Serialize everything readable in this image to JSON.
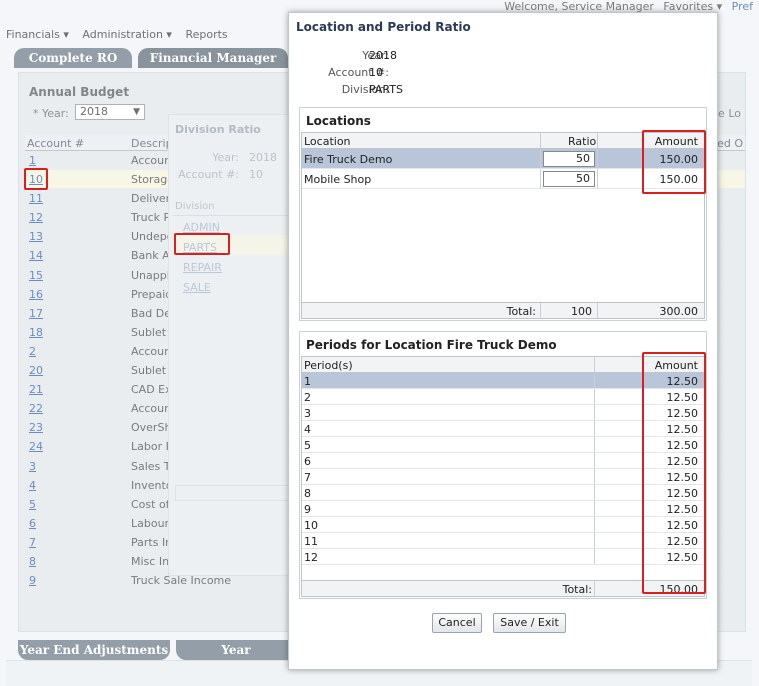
{
  "topbar": {
    "welcome": "Welcome, Service Manager",
    "favorites": "Favorites ▾",
    "prefs": "Pref"
  },
  "menu": {
    "financials": "Financials ▾",
    "administration": "Administration ▾",
    "reports": "Reports"
  },
  "tabs": {
    "complete_ro": "Complete RO",
    "financial_manager": "Financial Manager"
  },
  "bottom_tabs": {
    "year_end": "Year End Adjustments",
    "year_depr": "Year Depreciation"
  },
  "budget": {
    "title": "Annual Budget",
    "year_label": "* Year:",
    "year_value": "2018",
    "col_account": "Account #",
    "col_desc": "Descript",
    "right_label_1": "fine Lo",
    "right_label_2": "ased O",
    "rows": [
      {
        "acct": "1",
        "desc": "Account"
      },
      {
        "acct": "10",
        "desc": "Storage"
      },
      {
        "acct": "11",
        "desc": "Delivery"
      },
      {
        "acct": "12",
        "desc": "Truck P"
      },
      {
        "acct": "13",
        "desc": "Undepo"
      },
      {
        "acct": "14",
        "desc": "Bank Ac"
      },
      {
        "acct": "15",
        "desc": "Unappli"
      },
      {
        "acct": "16",
        "desc": "Prepaid"
      },
      {
        "acct": "17",
        "desc": "Bad Del"
      },
      {
        "acct": "18",
        "desc": "Sublet E"
      },
      {
        "acct": "2",
        "desc": "Account"
      },
      {
        "acct": "20",
        "desc": "Sublet L"
      },
      {
        "acct": "21",
        "desc": "CAD Ex"
      },
      {
        "acct": "22",
        "desc": "Account"
      },
      {
        "acct": "23",
        "desc": "OverSho"
      },
      {
        "acct": "24",
        "desc": "Labor E"
      },
      {
        "acct": "3",
        "desc": "Sales Ta"
      },
      {
        "acct": "4",
        "desc": "Invento"
      },
      {
        "acct": "5",
        "desc": "Cost of"
      },
      {
        "acct": "6",
        "desc": "Labour"
      },
      {
        "acct": "7",
        "desc": "Parts In"
      },
      {
        "acct": "8",
        "desc": "Misc Inc"
      },
      {
        "acct": "9",
        "desc": "Truck Sale Income"
      }
    ]
  },
  "division_ratio": {
    "title": "Division Ratio",
    "year_label": "Year:",
    "year_value": "2018",
    "account_label": "Account #:",
    "account_value": "10",
    "col_division": "Division",
    "items": [
      "ADMIN",
      "PARTS",
      "REPAIR",
      "SALE"
    ]
  },
  "dialog": {
    "title": "Location and Period Ratio",
    "year_label": "Year:",
    "year_value": "2018",
    "account_label": "Account #:",
    "account_value": "10",
    "division_label": "Division:",
    "division_value": "PARTS",
    "locations": {
      "title": "Locations",
      "col_location": "Location",
      "col_ratio": "Ratio",
      "col_amount": "Amount",
      "rows": [
        {
          "location": "Fire Truck Demo",
          "ratio": "50",
          "amount": "150.00"
        },
        {
          "location": "Mobile Shop",
          "ratio": "50",
          "amount": "150.00"
        }
      ],
      "total_label": "Total:",
      "total_ratio": "100",
      "total_amount": "300.00"
    },
    "periods": {
      "title": "Periods for Location Fire Truck Demo",
      "col_period": "Period(s)",
      "col_amount": "Amount",
      "rows": [
        {
          "period": "1",
          "amount": "12.50"
        },
        {
          "period": "2",
          "amount": "12.50"
        },
        {
          "period": "3",
          "amount": "12.50"
        },
        {
          "period": "4",
          "amount": "12.50"
        },
        {
          "period": "5",
          "amount": "12.50"
        },
        {
          "period": "6",
          "amount": "12.50"
        },
        {
          "period": "7",
          "amount": "12.50"
        },
        {
          "period": "8",
          "amount": "12.50"
        },
        {
          "period": "9",
          "amount": "12.50"
        },
        {
          "period": "10",
          "amount": "12.50"
        },
        {
          "period": "11",
          "amount": "12.50"
        },
        {
          "period": "12",
          "amount": "12.50"
        }
      ],
      "total_label": "Total:",
      "total_amount": "150.00"
    },
    "cancel_label": "Cancel",
    "save_label": "Save / Exit"
  },
  "colors": {
    "highlight": "#d82020",
    "selected_row": "#b9c5d8",
    "link": "#1a4f9c"
  }
}
